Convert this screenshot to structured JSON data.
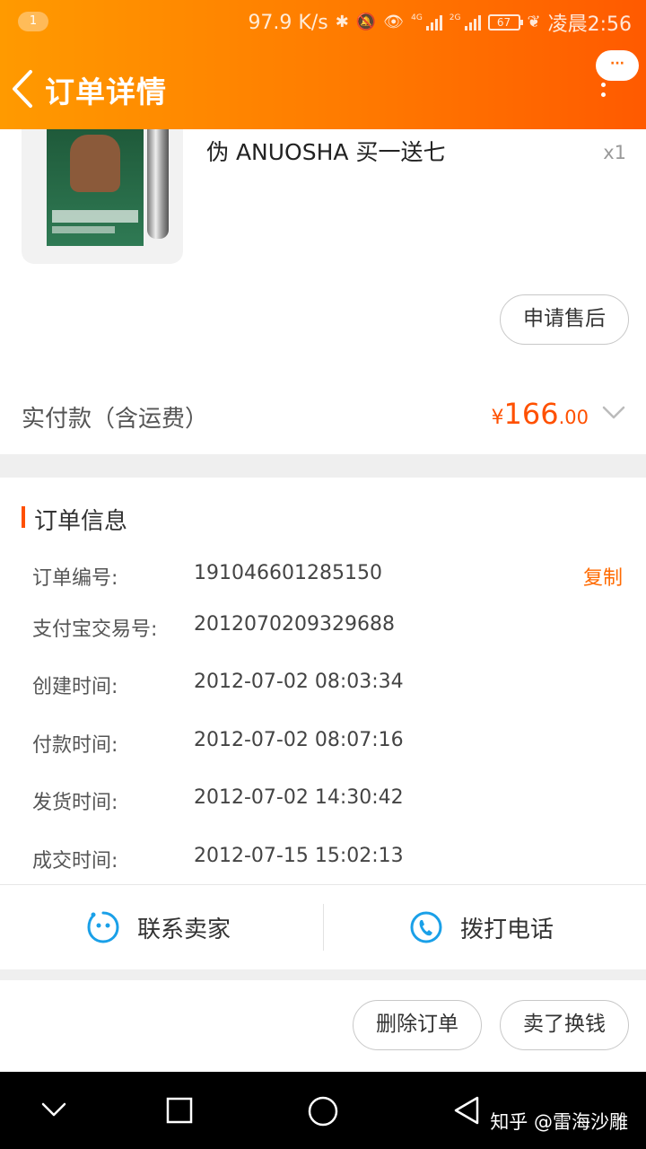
{
  "status_bar": {
    "notification_count": "1",
    "network_speed": "97.9 K/s",
    "signal_1_label": "4G",
    "signal_2_label": "2G",
    "battery": "67",
    "time": "凌晨2:56"
  },
  "header": {
    "title": "订单详情",
    "more_bubble": "···"
  },
  "product": {
    "name": "伪 ANUOSHA 买一送七",
    "quantity": "x1",
    "after_sale_label": "申请售后"
  },
  "payment": {
    "label": "实付款（含运费）",
    "currency": "¥",
    "amount_int": "166",
    "amount_dec": ".00"
  },
  "order_info": {
    "section_title": "订单信息",
    "copy_label": "复制",
    "rows": [
      {
        "label": "订单编号:",
        "value": "191046601285150"
      },
      {
        "label": "支付宝交易号:",
        "value": "2012070209329688"
      },
      {
        "label": "创建时间:",
        "value": "2012-07-02 08:03:34"
      },
      {
        "label": "付款时间:",
        "value": "2012-07-02 08:07:16"
      },
      {
        "label": "发货时间:",
        "value": "2012-07-02 14:30:42"
      },
      {
        "label": "成交时间:",
        "value": "2012-07-15 15:02:13"
      }
    ],
    "contact_seller": "联系卖家",
    "call_phone": "拨打电话"
  },
  "bottom_actions": {
    "delete_order": "删除订单",
    "sell_for_cash": "卖了换钱"
  },
  "watermark": "知乎 @雷海沙雕",
  "colors": {
    "accent": "#ff5000",
    "header_start": "#ff9a00",
    "header_end": "#ff5a00",
    "icon_blue": "#1aa0e8"
  }
}
